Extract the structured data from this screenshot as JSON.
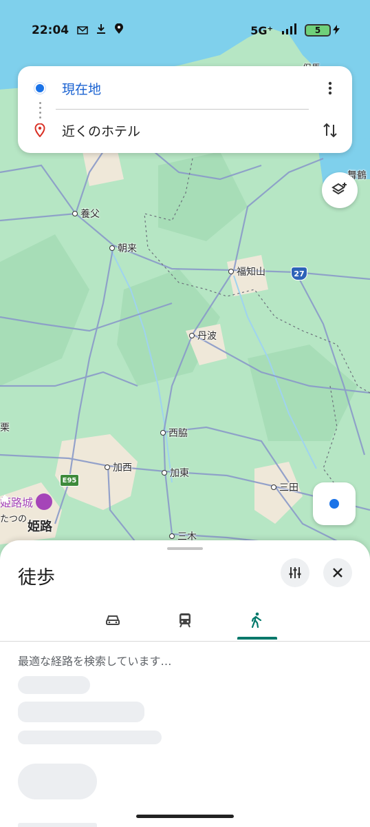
{
  "status_bar": {
    "time": "22:04",
    "network": "5G⁺",
    "battery": "5",
    "icons": [
      "mail-icon",
      "download-icon",
      "location-icon",
      "signal-icon",
      "battery-icon",
      "charging-icon"
    ]
  },
  "route": {
    "origin": "現在地",
    "destination": "近くのホテル",
    "icons": [
      "blue-dot-icon",
      "red-pin-icon",
      "more-vert-icon",
      "swap-icon"
    ]
  },
  "map": {
    "labels": {
      "yabu": "養父",
      "asago": "朝来",
      "fukuchiyama": "福知山",
      "tamba": "丹波",
      "nishiwaki": "西脇",
      "kasai": "加西",
      "kato": "加東",
      "sanda": "三田",
      "himeji": "姫路",
      "himeji_castle": "姫路城",
      "tatsuno": "たつの",
      "miki": "三木",
      "maizuru": "舞鶴",
      "toyooka": "但馬",
      "shiso": "栗"
    },
    "shields": {
      "route27": "27",
      "e95": "E95"
    },
    "colors": {
      "land": "#b6e6c4",
      "water": "#7fd0ec",
      "road": "#8a9ac9",
      "urban": "#efe8d9"
    }
  },
  "sheet": {
    "title": "徒歩",
    "modes": [
      "car-icon",
      "transit-icon",
      "walk-icon"
    ],
    "active_mode": "walk",
    "searching_text": "最適な経路を検索しています…",
    "accent_color": "#00786a"
  }
}
